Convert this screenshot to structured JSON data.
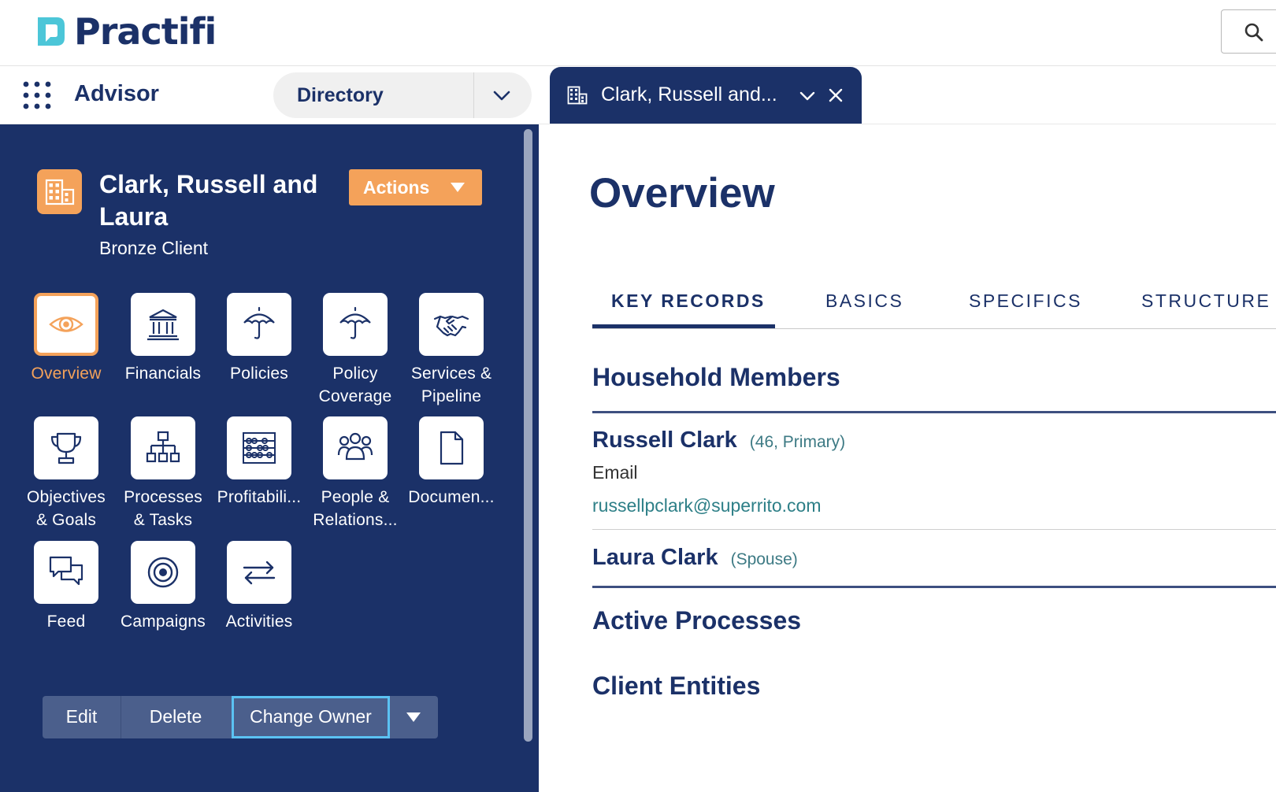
{
  "app": {
    "logo_text": "Practifi",
    "name": "Advisor",
    "directory_label": "Directory",
    "record_tab_label": "Clark, Russell and..."
  },
  "record": {
    "title": "Clark, Russell and Laura",
    "subtitle": "Bronze Client",
    "actions_label": "Actions",
    "icon": "building-icon"
  },
  "nav_tiles": [
    {
      "label": "Overview",
      "icon": "eye-icon",
      "active": true
    },
    {
      "label": "Financials",
      "icon": "bank-icon"
    },
    {
      "label": "Policies",
      "icon": "umbrella-icon"
    },
    {
      "label": "Policy\nCoverage",
      "icon": "umbrella-icon"
    },
    {
      "label": "Services &\nPipeline",
      "icon": "handshake-icon"
    },
    {
      "label": "Objectives\n& Goals",
      "icon": "trophy-icon"
    },
    {
      "label": "Processes\n& Tasks",
      "icon": "hierarchy-icon"
    },
    {
      "label": "Profitabili...",
      "icon": "abacus-icon"
    },
    {
      "label": "People &\nRelations...",
      "icon": "people-icon"
    },
    {
      "label": "Documen...",
      "icon": "document-icon"
    },
    {
      "label": "Feed",
      "icon": "chat-icon"
    },
    {
      "label": "Campaigns",
      "icon": "target-icon"
    },
    {
      "label": "Activities",
      "icon": "arrows-icon"
    }
  ],
  "record_buttons": {
    "edit": "Edit",
    "delete": "Delete",
    "change_owner": "Change Owner"
  },
  "main": {
    "title": "Overview",
    "tabs": [
      "KEY RECORDS",
      "BASICS",
      "SPECIFICS",
      "STRUCTURE"
    ],
    "active_tab": "KEY RECORDS",
    "household_title": "Household Members",
    "members": [
      {
        "name": "Russell Clark",
        "meta": "(46, Primary)",
        "email_label": "Email",
        "email": "russellpclark@superrito.com"
      },
      {
        "name": "Laura Clark",
        "meta": "(Spouse)"
      }
    ],
    "active_processes_title": "Active Processes",
    "client_entities_title": "Client Entities"
  },
  "colors": {
    "navy": "#1b3168",
    "accent_orange": "#f4a25a",
    "focus_blue": "#5bc2f3",
    "link_teal": "#2d7f87"
  }
}
